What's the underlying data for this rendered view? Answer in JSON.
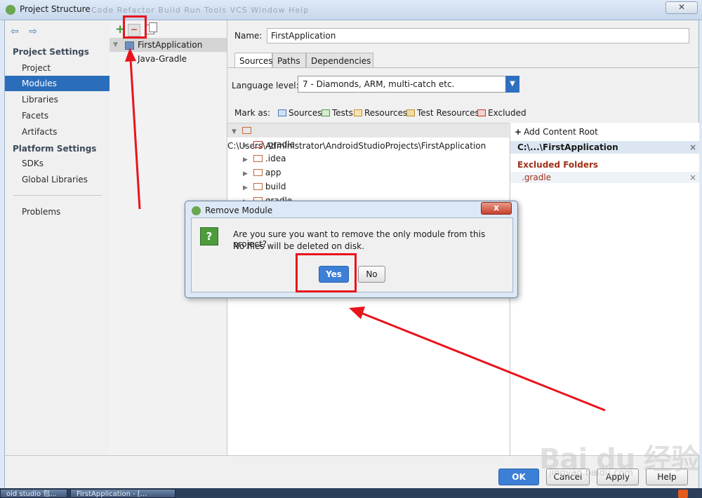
{
  "window": {
    "title": "Project Structure",
    "ghost_menu": "Code  Refactor  Build  Run  Tools  VCS  Window  Help",
    "close": "✕"
  },
  "nav": {
    "back": "⇦",
    "forward": "⇨",
    "project_settings": "Project Settings",
    "platform_settings": "Platform Settings",
    "items": [
      "Project",
      "Modules",
      "Libraries",
      "Facets",
      "Artifacts"
    ],
    "platform_items": [
      "SDKs",
      "Global Libraries"
    ],
    "problems": "Problems"
  },
  "tree": {
    "add": "+",
    "remove": "−",
    "root": "FirstApplication",
    "child": "Java-Gradle"
  },
  "name": {
    "label": "Name:",
    "value": "FirstApplication"
  },
  "tabs": [
    "Sources",
    "Paths",
    "Dependencies"
  ],
  "language": {
    "label": "Language level:",
    "value": "7 - Diamonds, ARM, multi-catch etc."
  },
  "markas": {
    "label": "Mark as:",
    "items": [
      "Sources",
      "Tests",
      "Resources",
      "Test Resources",
      "Excluded"
    ]
  },
  "roots": {
    "path": "C:\\Users\\Administrator\\AndroidStudioProjects\\FirstApplication",
    "folders": [
      ".gradle",
      ".idea",
      "app",
      "build",
      "gradle"
    ]
  },
  "content_root": {
    "add": "Add Content Root",
    "path": "C:\\...\\FirstApplication",
    "excluded_heading": "Excluded Folders",
    "excluded_item": ".gradle",
    "remove": "×"
  },
  "dialog": {
    "title": "Remove Module",
    "close": "x",
    "icon": "?",
    "line1": "Are you sure you want to remove the only module from this project?",
    "line2": "No files will be deleted on disk.",
    "yes": "Yes",
    "no": "No"
  },
  "buttons": {
    "ok": "OK",
    "cancel": "Cancel",
    "apply": "Apply",
    "help": "Help"
  },
  "watermark": {
    "logo": "Bai du 经验",
    "url": "jingyan.baidu.com"
  },
  "taskbar": [
    "oid studio 包...",
    "FirstApplication - [..."
  ],
  "colors": {
    "accent": "#2a6ebb",
    "annotation": "#e8141c",
    "excluded": "#a03018"
  }
}
